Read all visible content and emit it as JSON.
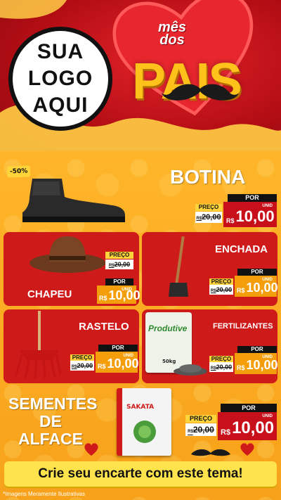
{
  "header": {
    "logo_line1": "SUA",
    "logo_line2": "LOGO",
    "logo_line3": "AQUI",
    "campaign_small_1": "mês",
    "campaign_small_2": "dos",
    "campaign_big": "PAIS"
  },
  "featured": {
    "badge": "-50%",
    "title": "BOTINA",
    "price": {
      "preco_label": "PREÇO",
      "por_label": "POR",
      "old_prefix": "R$",
      "old_value": "20,00",
      "currency": "R$",
      "value": "10,00",
      "unit": "UNID"
    }
  },
  "cards": [
    {
      "title": "CHAPEU",
      "price": {
        "preco_label": "PREÇO",
        "por_label": "POR",
        "old_prefix": "R$",
        "old_value": "20,00",
        "currency": "R$",
        "value": "10,00",
        "unit": "UNID"
      }
    },
    {
      "title": "ENCHADA",
      "price": {
        "preco_label": "PREÇO",
        "por_label": "POR",
        "old_prefix": "R$",
        "old_value": "20,00",
        "currency": "R$",
        "value": "10,00",
        "unit": "UNID"
      }
    },
    {
      "title": "RASTELO",
      "price": {
        "preco_label": "PREÇO",
        "por_label": "POR",
        "old_prefix": "R$",
        "old_value": "20,00",
        "currency": "R$",
        "value": "10,00",
        "unit": "UNID"
      }
    },
    {
      "title": "FERTILIZANTES",
      "bag_brand": "Produtive",
      "bag_weight": "50kg",
      "price": {
        "preco_label": "PREÇO",
        "por_label": "POR",
        "old_prefix": "R$",
        "old_value": "20,00",
        "currency": "R$",
        "value": "10,00",
        "unit": "UNID"
      }
    }
  ],
  "seeds": {
    "title_line1": "SEMENTES",
    "title_line2": "DE",
    "title_line3": "ALFACE",
    "pack_brand": "SAKATA",
    "price": {
      "preco_label": "PREÇO",
      "por_label": "POR",
      "old_prefix": "R$",
      "old_value": "20,00",
      "currency": "R$",
      "value": "10,00",
      "unit": "UNID"
    }
  },
  "cta": "Crie seu encarte com este tema!",
  "disclaimer": "*Imagens Meramente Ilustrativas",
  "colors": {
    "red": "#c8101a",
    "orange": "#f7a21a",
    "yellow": "#ffd43b",
    "gold": "#ffc21a"
  }
}
